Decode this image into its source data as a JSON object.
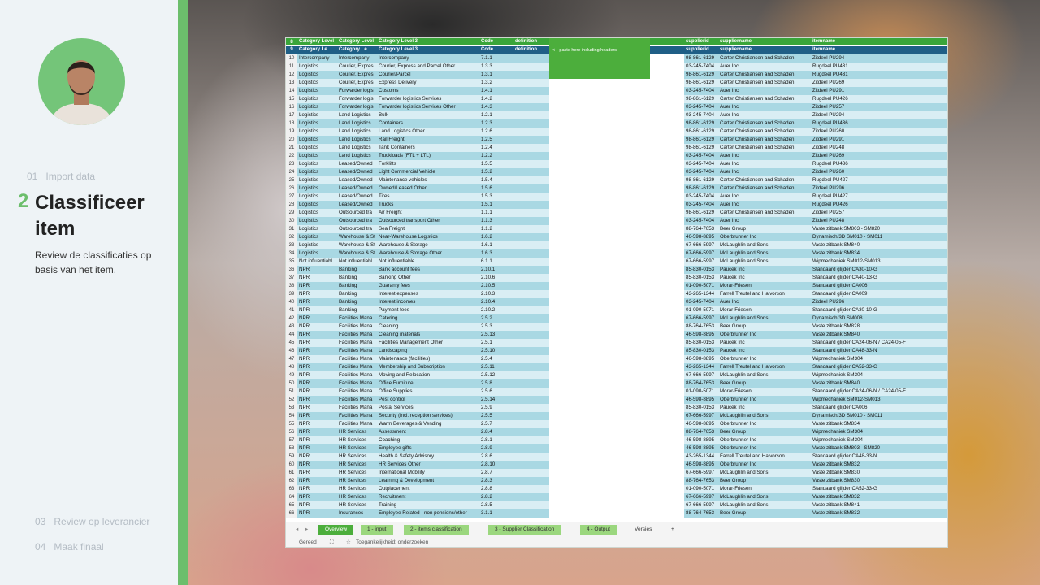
{
  "steps": [
    {
      "num": "01",
      "label": "Import data"
    },
    {
      "num": "2",
      "label": "Classificeer item",
      "description": "Review de classificaties op basis van het item."
    },
    {
      "num": "03",
      "label": "Review op leverancier"
    },
    {
      "num": "04",
      "label": "Maak finaal"
    }
  ],
  "colors": {
    "accent": "#6cbe6c",
    "sheet_header": "#3aa53a",
    "row_blue": "#a9d8e3"
  },
  "sheet": {
    "header_row_numbers": [
      "8",
      "9"
    ],
    "headers": [
      "Category Level",
      "Category Level",
      "Category Level 3",
      "Code",
      "definition"
    ],
    "headers_filter": [
      "Category Le",
      "Category Le",
      "Category Level 3",
      "Code",
      "definition"
    ],
    "paste_hint": "<-- paste here including headers",
    "supplier_headers": [
      "supplierid",
      "suppliername",
      "itemname"
    ],
    "rows": [
      [
        "10",
        "Intercompany",
        "Intercompany",
        "Intercompany",
        "7.1.1",
        "98-861-6129",
        "Carter Christiansen and Schaden",
        "Zitdeel PU294"
      ],
      [
        "11",
        "Logistics",
        "Courier, Expres",
        "Courier, Express and Parcel Other",
        "1.3.3",
        "03-245-7404",
        "Auer Inc",
        "Rugdeel PU431"
      ],
      [
        "12",
        "Logistics",
        "Courier, Expres",
        "Courier/Parcel",
        "1.3.1",
        "98-861-6129",
        "Carter Christiansen and Schaden",
        "Rugdeel PU431"
      ],
      [
        "13",
        "Logistics",
        "Courier, Expres",
        "Express Delivery",
        "1.3.2",
        "98-861-6129",
        "Carter Christiansen and Schaden",
        "Zitdeel PU269"
      ],
      [
        "14",
        "Logistics",
        "Forwarder logis",
        "Customs",
        "1.4.1",
        "03-245-7404",
        "Auer Inc",
        "Zitdeel PU291"
      ],
      [
        "15",
        "Logistics",
        "Forwarder logis",
        "Forwarder logistics Services",
        "1.4.2",
        "98-861-6129",
        "Carter Christiansen and Schaden",
        "Rugdeel PU426"
      ],
      [
        "16",
        "Logistics",
        "Forwarder logis",
        "Forwarder logistics Services Other",
        "1.4.3",
        "03-245-7404",
        "Auer Inc",
        "Zitdeel PU257"
      ],
      [
        "17",
        "Logistics",
        "Land Logistics",
        "Bulk",
        "1.2.1",
        "03-245-7404",
        "Auer Inc",
        "Zitdeel PU294"
      ],
      [
        "18",
        "Logistics",
        "Land Logistics",
        "Containers",
        "1.2.3",
        "98-861-6129",
        "Carter Christiansen and Schaden",
        "Rugdeel PU436"
      ],
      [
        "19",
        "Logistics",
        "Land Logistics",
        "Land Logistics Other",
        "1.2.6",
        "98-861-6129",
        "Carter Christiansen and Schaden",
        "Zitdeel PU260"
      ],
      [
        "20",
        "Logistics",
        "Land Logistics",
        "Rail Freight",
        "1.2.5",
        "98-861-6129",
        "Carter Christiansen and Schaden",
        "Zitdeel PU291"
      ],
      [
        "21",
        "Logistics",
        "Land Logistics",
        "Tank Containers",
        "1.2.4",
        "98-861-6129",
        "Carter Christiansen and Schaden",
        "Zitdeel PU248"
      ],
      [
        "22",
        "Logistics",
        "Land Logistics",
        "Truckloads (FTL + LTL)",
        "1.2.2",
        "03-245-7404",
        "Auer Inc",
        "Zitdeel PU269"
      ],
      [
        "23",
        "Logistics",
        "Leased/Owned",
        "Forklifts",
        "1.5.5",
        "03-245-7404",
        "Auer Inc",
        "Rugdeel PU436"
      ],
      [
        "24",
        "Logistics",
        "Leased/Owned",
        "Light Commercial Vehicle",
        "1.5.2",
        "03-245-7404",
        "Auer Inc",
        "Zitdeel PU260"
      ],
      [
        "25",
        "Logistics",
        "Leased/Owned",
        "Maintenance vehicles",
        "1.5.4",
        "98-861-6129",
        "Carter Christiansen and Schaden",
        "Rugdeel PU427"
      ],
      [
        "26",
        "Logistics",
        "Leased/Owned",
        "Owned/Leased Other",
        "1.5.6",
        "98-861-6129",
        "Carter Christiansen and Schaden",
        "Zitdeel PU296"
      ],
      [
        "27",
        "Logistics",
        "Leased/Owned",
        "Tires",
        "1.5.3",
        "03-245-7404",
        "Auer Inc",
        "Rugdeel PU427"
      ],
      [
        "28",
        "Logistics",
        "Leased/Owned",
        "Trucks",
        "1.5.1",
        "03-245-7404",
        "Auer Inc",
        "Rugdeel PU426"
      ],
      [
        "29",
        "Logistics",
        "Outsourced tra",
        "Air Freight",
        "1.1.1",
        "98-861-6129",
        "Carter Christiansen and Schaden",
        "Zitdeel PU257"
      ],
      [
        "30",
        "Logistics",
        "Outsourced tra",
        "Outsourced transport Other",
        "1.1.3",
        "03-245-7404",
        "Auer Inc",
        "Zitdeel PU248"
      ],
      [
        "31",
        "Logistics",
        "Outsourced tra",
        "Sea Freight",
        "1.1.2",
        "88-764-7653",
        "Beer Group",
        "Vaste zitbank SM803 - SM820"
      ],
      [
        "32",
        "Logistics",
        "Warehouse & St",
        "Near-Warehouse Logistics",
        "1.6.2",
        "46-598-8895",
        "Oberbrunner Inc",
        "Dynamisch/3D SM010 - SM011"
      ],
      [
        "33",
        "Logistics",
        "Warehouse & St",
        "Warehouse & Storage",
        "1.6.1",
        "67-666-5997",
        "McLaughlin and Sons",
        "Vaste zitbank SM840"
      ],
      [
        "34",
        "Logistics",
        "Warehouse & St",
        "Warehouse & Storage Other",
        "1.6.3",
        "67-666-5997",
        "McLaughlin and Sons",
        "Vaste zitbank SM834"
      ],
      [
        "35",
        "Not influentiabl",
        "Not influentiabl",
        "Not influentiable",
        "6.1.1",
        "67-666-5997",
        "McLaughlin and Sons",
        "Wipmechaniek SM012-SM013"
      ],
      [
        "36",
        "NPR",
        "Banking",
        "Bank account fees",
        "2.10.1",
        "85-830-0153",
        "Paucek Inc",
        "Standaard glijder CA30-10-G"
      ],
      [
        "37",
        "NPR",
        "Banking",
        "Banking Other",
        "2.10.6",
        "85-830-0153",
        "Paucek Inc",
        "Standaard glijder CA40-13-G"
      ],
      [
        "38",
        "NPR",
        "Banking",
        "Guaranty fees",
        "2.10.5",
        "01-090-5071",
        "Morar-Friesen",
        "Standaard glijder CA006"
      ],
      [
        "39",
        "NPR",
        "Banking",
        "Interest expenses",
        "2.10.3",
        "43-265-1344",
        "Farrell Treutel and Halvorson",
        "Standaard glijder CA009"
      ],
      [
        "40",
        "NPR",
        "Banking",
        "Interest incomes",
        "2.10.4",
        "03-245-7404",
        "Auer Inc",
        "Zitdeel PU296"
      ],
      [
        "41",
        "NPR",
        "Banking",
        "Payment fees",
        "2.10.2",
        "01-090-5071",
        "Morar-Friesen",
        "Standaard glijder CA30-10-G"
      ],
      [
        "42",
        "NPR",
        "Facilities Mana",
        "Catering",
        "2.5.2",
        "67-666-5997",
        "McLaughlin and Sons",
        "Dynamisch/3D SM008"
      ],
      [
        "43",
        "NPR",
        "Facilities Mana",
        "Cleaning",
        "2.5.3",
        "88-764-7653",
        "Beer Group",
        "Vaste zitbank SM828"
      ],
      [
        "44",
        "NPR",
        "Facilities Mana",
        "Cleaning materials",
        "2.5.13",
        "46-598-8895",
        "Oberbrunner Inc",
        "Vaste zitbank SM840"
      ],
      [
        "45",
        "NPR",
        "Facilities Mana",
        "Facilities Management Other",
        "2.5.1",
        "85-830-0153",
        "Paucek Inc",
        "Standaard glijder CA24-06-N / CA24-05-F"
      ],
      [
        "46",
        "NPR",
        "Facilities Mana",
        "Landscaping",
        "2.5.10",
        "85-830-0153",
        "Paucek Inc",
        "Standaard glijder CA48-33-N"
      ],
      [
        "47",
        "NPR",
        "Facilities Mana",
        "Maintenance (facilities)",
        "2.5.4",
        "46-598-8895",
        "Oberbrunner Inc",
        "Wipmechaniek SM304"
      ],
      [
        "48",
        "NPR",
        "Facilities Mana",
        "Membership and Subscription",
        "2.5.11",
        "43-265-1344",
        "Farrell Treutel and Halvorson",
        "Standaard glijder CA52-33-G"
      ],
      [
        "49",
        "NPR",
        "Facilities Mana",
        "Moving and Relocation",
        "2.5.12",
        "67-666-5997",
        "McLaughlin and Sons",
        "Wipmechaniek SM304"
      ],
      [
        "50",
        "NPR",
        "Facilities Mana",
        "Office Furniture",
        "2.5.8",
        "88-764-7653",
        "Beer Group",
        "Vaste zitbank SM840"
      ],
      [
        "51",
        "NPR",
        "Facilities Mana",
        "Office Supplies",
        "2.5.6",
        "01-090-5071",
        "Morar-Friesen",
        "Standaard glijder CA24-06-N / CA24-05-F"
      ],
      [
        "52",
        "NPR",
        "Facilities Mana",
        "Pest control",
        "2.5.14",
        "46-598-8895",
        "Oberbrunner Inc",
        "Wipmechaniek SM012-SM013"
      ],
      [
        "53",
        "NPR",
        "Facilities Mana",
        "Postal Services",
        "2.5.9",
        "85-830-0153",
        "Paucek Inc",
        "Standaard glijder CA006"
      ],
      [
        "54",
        "NPR",
        "Facilities Mana",
        "Security (incl. reception services)",
        "2.5.5",
        "67-666-5997",
        "McLaughlin and Sons",
        "Dynamisch/3D SM010 - SM011"
      ],
      [
        "55",
        "NPR",
        "Facilities Mana",
        "Warm Beverages & Vending",
        "2.5.7",
        "46-598-8895",
        "Oberbrunner Inc",
        "Vaste zitbank SM834"
      ],
      [
        "56",
        "NPR",
        "HR Services",
        "Assessment",
        "2.8.4",
        "88-764-7653",
        "Beer Group",
        "Wipmechaniek SM304"
      ],
      [
        "57",
        "NPR",
        "HR Services",
        "Coaching",
        "2.8.1",
        "46-598-8895",
        "Oberbrunner Inc",
        "Wipmechaniek SM304"
      ],
      [
        "58",
        "NPR",
        "HR Services",
        "Employee gifts",
        "2.8.9",
        "46-598-8895",
        "Oberbrunner Inc",
        "Vaste zitbank SM803 - SM820"
      ],
      [
        "59",
        "NPR",
        "HR Services",
        "Health & Safety Advisory",
        "2.8.6",
        "43-265-1344",
        "Farrell Treutel and Halvorson",
        "Standaard glijder CA48-33-N"
      ],
      [
        "60",
        "NPR",
        "HR Services",
        "HR Services Other",
        "2.8.10",
        "46-598-8895",
        "Oberbrunner Inc",
        "Vaste zitbank SM832"
      ],
      [
        "61",
        "NPR",
        "HR Services",
        "International Mobility",
        "2.8.7",
        "67-666-5997",
        "McLaughlin and Sons",
        "Vaste zitbank SM830"
      ],
      [
        "62",
        "NPR",
        "HR Services",
        "Learning & Development",
        "2.8.3",
        "88-764-7653",
        "Beer Group",
        "Vaste zitbank SM830"
      ],
      [
        "63",
        "NPR",
        "HR Services",
        "Outplacement",
        "2.8.8",
        "01-090-5071",
        "Morar-Friesen",
        "Standaard glijder CA52-33-G"
      ],
      [
        "64",
        "NPR",
        "HR Services",
        "Recruitment",
        "2.8.2",
        "67-666-5997",
        "McLaughlin and Sons",
        "Vaste zitbank SM832"
      ],
      [
        "65",
        "NPR",
        "HR Services",
        "Training",
        "2.8.5",
        "67-666-5997",
        "McLaughlin and Sons",
        "Vaste zitbank SM841"
      ],
      [
        "66",
        "NPR",
        "Insurances",
        "Employee Related - non pensions/other",
        "3.1.1",
        "88-764-7653",
        "Beer Group",
        "Vaste zitbank SM832"
      ]
    ],
    "tabs": [
      "Overview",
      "1 - input",
      "2 - items classification",
      "3 - Supplier Classification",
      "4 - Output",
      "Versies",
      "+"
    ],
    "status": {
      "ready": "Gereed",
      "accessibility": "Toegankelijkheid: onderzoeken"
    }
  }
}
